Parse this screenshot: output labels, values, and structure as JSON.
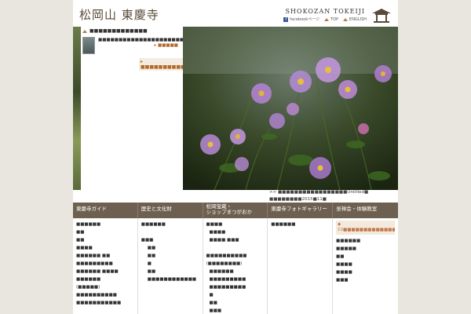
{
  "header": {
    "logo": "松岡山 東慶寺",
    "brand_en": "SHOKOZAN TOKEIJI",
    "links": [
      "facebookページ",
      "TOP",
      "ENGLISH"
    ]
  },
  "news": {
    "title": "■■■■■■■■■■■■■",
    "item_text": "■■■■■■■■■■■■■■■■■■■■■■■■■",
    "item_more": "■■■■■",
    "more_link": "■■■■■■■■■■"
  },
  "caption": ">> ■■■■■■■■■■■■■■■■■Untitled■ ■■■■■■■■2015■11■",
  "nav": [
    "東慶寺ガイド",
    "歴史と文化財",
    "松岡宝蔵・\nショップまつがおか",
    "東慶寺フォトギャラリー",
    "坐禅会・体験教室"
  ],
  "columns": [
    [
      "■■■■■■",
      "■■",
      "■■",
      "■■■■",
      "■■■■■■ ■■",
      "■■■■■■■■■",
      "■■■■■■ ■■■■",
      "■■■■■■",
      "(■■■■■)",
      "■■■■■■■■■■",
      "■■■■■■■■■■■"
    ],
    [
      "■■■■■■",
      "",
      "■■■",
      "■■",
      "■■",
      "■",
      "■■",
      "■■■■■■■■■■■■"
    ],
    [
      "■■■■",
      "■■■■",
      "■■■■ ■■■",
      "",
      "■■■■■■■■■■",
      "(■■■■■■■■)",
      "■■■■■■",
      "■■■■■■■■■",
      "■■■■■■■■■",
      "■",
      "■■",
      "■■■",
      "■■■"
    ],
    [
      "■■■■■■"
    ],
    [
      "10■■■■■■■■■■■■■■■■■■",
      "■■■■■■",
      "■■■■■",
      "■■",
      "■■■■",
      "■■■■",
      "■■■"
    ]
  ]
}
